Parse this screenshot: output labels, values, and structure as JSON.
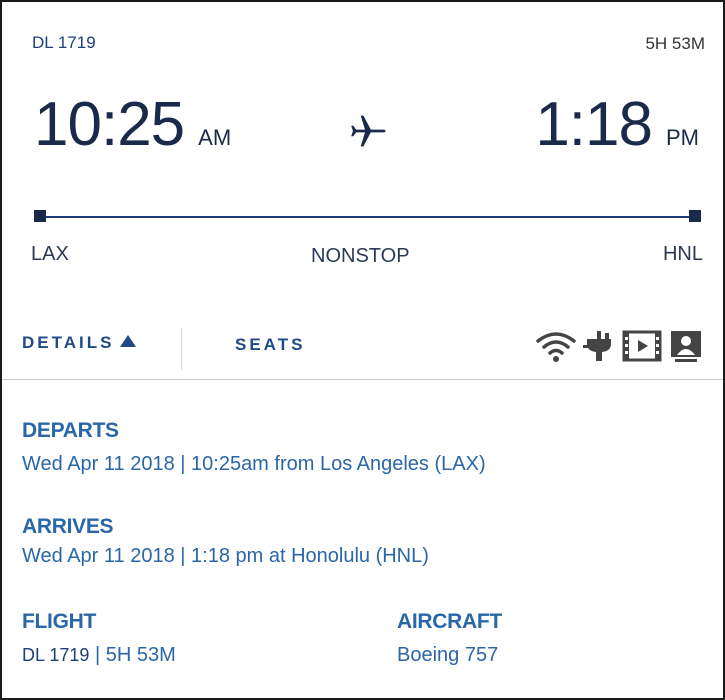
{
  "header": {
    "flight_number": "DL 1719",
    "duration": "5H 53M"
  },
  "departure": {
    "time": "10:25",
    "ampm": "AM",
    "airport_code": "LAX"
  },
  "arrival": {
    "time": "1:18",
    "ampm": "PM",
    "airport_code": "HNL"
  },
  "route": {
    "stops_label": "NONSTOP"
  },
  "tabs": {
    "details_label": "DETAILS",
    "seats_label": "SEATS"
  },
  "amenities": [
    "wifi-icon",
    "power-outlet-icon",
    "video-icon",
    "personal-screen-icon"
  ],
  "details": {
    "departs_label": "DEPARTS",
    "departs_value": "Wed Apr 11 2018 | 10:25am from Los Angeles (LAX)",
    "arrives_label": "ARRIVES",
    "arrives_value": "Wed Apr 11 2018 | 1:18 pm at Honolulu (HNL)",
    "flight_label": "FLIGHT",
    "flight_number": "DL 1719",
    "flight_separator": " | ",
    "flight_duration": "5H 53M",
    "aircraft_label": "AIRCRAFT",
    "aircraft_value": "Boeing 757"
  },
  "colors": {
    "navy": "#1b2a4a",
    "accent_blue": "#2a67a8",
    "tab_blue": "#1f4a8a"
  }
}
